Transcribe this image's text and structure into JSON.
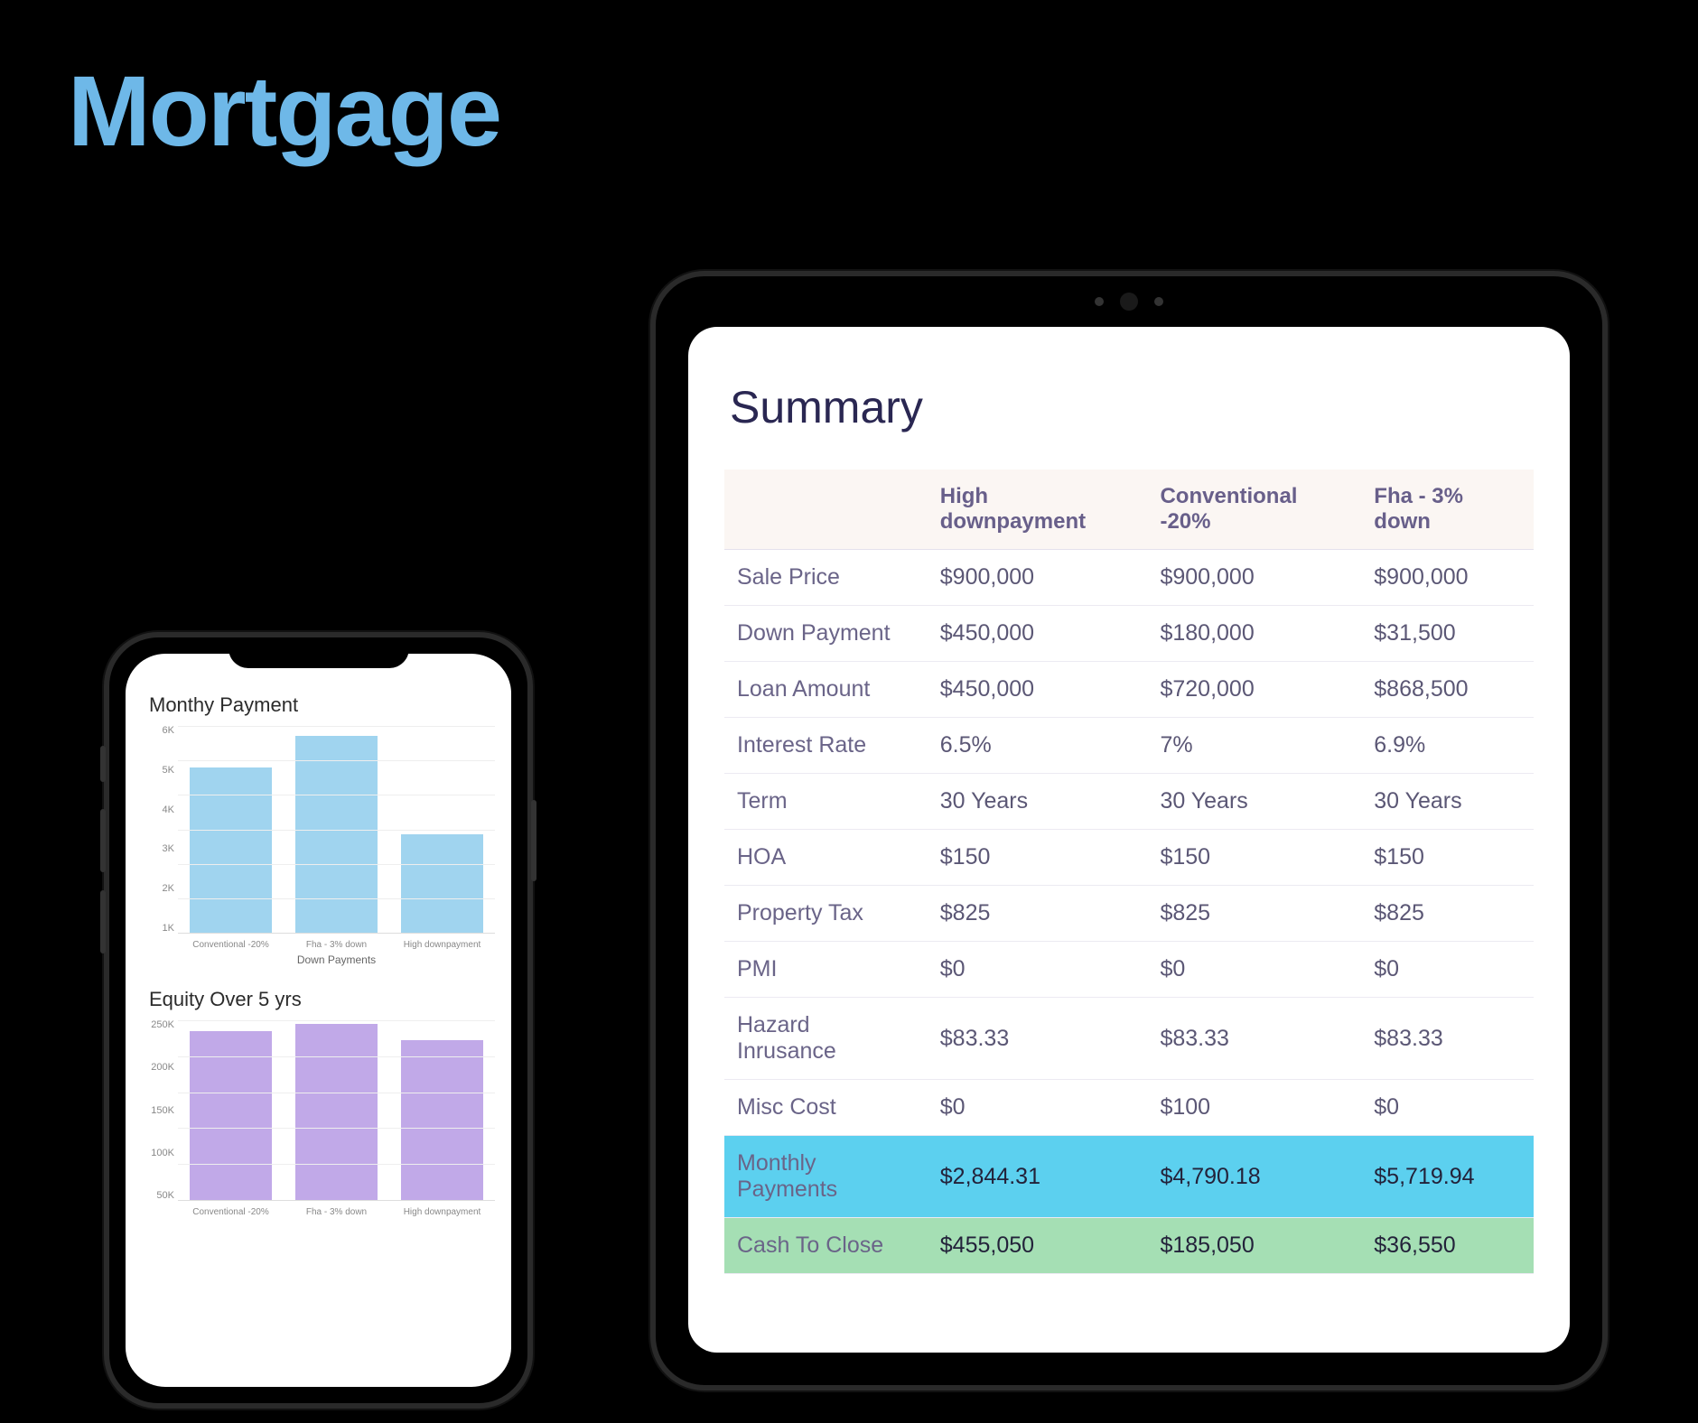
{
  "page": {
    "title": "Mortgage"
  },
  "tablet": {
    "summary_title": "Summary",
    "columns": [
      "",
      "High downpayment",
      "Conventional -20%",
      "Fha - 3% down"
    ],
    "rows": [
      {
        "label": "Sale Price",
        "cells": [
          "$900,000",
          "$900,000",
          "$900,000"
        ],
        "class": ""
      },
      {
        "label": "Down Payment",
        "cells": [
          "$450,000",
          "$180,000",
          "$31,500"
        ],
        "class": ""
      },
      {
        "label": "Loan Amount",
        "cells": [
          "$450,000",
          "$720,000",
          "$868,500"
        ],
        "class": ""
      },
      {
        "label": "Interest Rate",
        "cells": [
          "6.5%",
          "7%",
          "6.9%"
        ],
        "class": ""
      },
      {
        "label": "Term",
        "cells": [
          "30 Years",
          "30 Years",
          "30 Years"
        ],
        "class": ""
      },
      {
        "label": "HOA",
        "cells": [
          "$150",
          "$150",
          "$150"
        ],
        "class": ""
      },
      {
        "label": "Property Tax",
        "cells": [
          "$825",
          "$825",
          "$825"
        ],
        "class": ""
      },
      {
        "label": "PMI",
        "cells": [
          "$0",
          "$0",
          "$0"
        ],
        "class": ""
      },
      {
        "label": "Hazard Inrusance",
        "cells": [
          "$83.33",
          "$83.33",
          "$83.33"
        ],
        "class": ""
      },
      {
        "label": "Misc Cost",
        "cells": [
          "$0",
          "$100",
          "$0"
        ],
        "class": ""
      },
      {
        "label": "Monthly Payments",
        "cells": [
          "$2,844.31",
          "$4,790.18",
          "$5,719.94"
        ],
        "class": "row-monthly"
      },
      {
        "label": "Cash To Close",
        "cells": [
          "$455,050",
          "$185,050",
          "$36,550"
        ],
        "class": "row-cash"
      }
    ]
  },
  "phone": {
    "chart1": {
      "title": "Monthy Payment",
      "xlabel": "Down Payments",
      "color": "#a0d4ef"
    },
    "chart2": {
      "title": "Equity  Over 5 yrs",
      "xlabel": "",
      "color": "#c1a9e8"
    }
  },
  "chart_data": [
    {
      "type": "bar",
      "title": "Monthy Payment",
      "xlabel": "Down Payments",
      "ylabel": "",
      "ylim": [
        0,
        6000
      ],
      "yticks": [
        "6K",
        "5K",
        "4K",
        "3K",
        "2K",
        "1K"
      ],
      "categories": [
        "Conventional -20%",
        "Fha - 3% down",
        "High downpayment"
      ],
      "values": [
        4790,
        5720,
        2844
      ],
      "color": "#a0d4ef"
    },
    {
      "type": "bar",
      "title": "Equity  Over 5 yrs",
      "xlabel": "",
      "ylabel": "",
      "ylim": [
        0,
        250000
      ],
      "yticks": [
        "250K",
        "200K",
        "150K",
        "100K",
        "50K"
      ],
      "categories": [
        "Conventional -20%",
        "Fha - 3% down",
        "High downpayment"
      ],
      "values": [
        235000,
        245000,
        222000
      ],
      "color": "#c1a9e8"
    }
  ]
}
